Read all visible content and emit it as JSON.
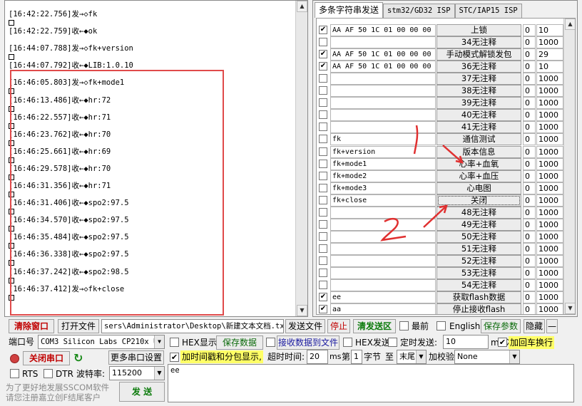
{
  "log": {
    "lines": [
      {
        "text": "[16:42:22.756]发→◇fk",
        "box": true
      },
      {
        "text": "[16:42:22.759]收←◆ok",
        "box": false
      },
      {
        "text": "[16:44:07.788]发→◇fk+version",
        "box": true
      },
      {
        "text": "[16:44:07.792]收←◆LIB:1.0.10",
        "box": false
      },
      {
        "text": "[16:46:05.803]发→◇fk+mode1",
        "box": true
      },
      {
        "text": "[16:46:13.486]收←◆hr:72",
        "box": true
      },
      {
        "text": "[16:46:22.557]收←◆hr:71",
        "box": true
      },
      {
        "text": "[16:46:23.762]收←◆hr:70",
        "box": true
      },
      {
        "text": "[16:46:25.661]收←◆hr:69",
        "box": true
      },
      {
        "text": "[16:46:29.578]收←◆hr:70",
        "box": true
      },
      {
        "text": "[16:46:31.356]收←◆hr:71",
        "box": true
      },
      {
        "text": "[16:46:31.406]收←◆spo2:97.5",
        "box": true
      },
      {
        "text": "[16:46:34.570]收←◆spo2:97.5",
        "box": true
      },
      {
        "text": "[16:46:35.484]收←◆spo2:97.5",
        "box": true
      },
      {
        "text": "[16:46:36.338]收←◆spo2:97.5",
        "box": true
      },
      {
        "text": "[16:46:37.242]收←◆spo2:98.5",
        "box": true
      },
      {
        "text": "[16:46:37.412]发→◇fk+close",
        "box": true
      }
    ]
  },
  "tabs": [
    "多条字符串发送",
    "stm32/GD32 ISP",
    "STC/IAP15 ISP"
  ],
  "commands": [
    {
      "checked": true,
      "data": "AA AF 50 1C 01 00 00 00",
      "label": "上锁",
      "order": "0",
      "delay": "10"
    },
    {
      "checked": false,
      "data": "",
      "label": "34无注释",
      "order": "0",
      "delay": "1000"
    },
    {
      "checked": true,
      "data": "AA AF 50 1C 01 00 00 00",
      "label": "手动模式解锁发包",
      "order": "0",
      "delay": "29"
    },
    {
      "checked": true,
      "data": "AA AF 50 1C 01 00 00 00",
      "label": "36无注释",
      "order": "0",
      "delay": "10"
    },
    {
      "checked": false,
      "data": "",
      "label": "37无注释",
      "order": "0",
      "delay": "1000"
    },
    {
      "checked": false,
      "data": "",
      "label": "38无注释",
      "order": "0",
      "delay": "1000"
    },
    {
      "checked": false,
      "data": "",
      "label": "39无注释",
      "order": "0",
      "delay": "1000"
    },
    {
      "checked": false,
      "data": "",
      "label": "40无注释",
      "order": "0",
      "delay": "1000"
    },
    {
      "checked": false,
      "data": "",
      "label": "41无注释",
      "order": "0",
      "delay": "1000"
    },
    {
      "checked": false,
      "data": "fk",
      "label": "通信测试",
      "order": "0",
      "delay": "1000"
    },
    {
      "checked": false,
      "data": "fk+version",
      "label": "版本信息",
      "order": "0",
      "delay": "1000"
    },
    {
      "checked": false,
      "data": "fk+mode1",
      "label": "心率+血氧",
      "order": "0",
      "delay": "1000"
    },
    {
      "checked": false,
      "data": "fk+mode2",
      "label": "心率+血压",
      "order": "0",
      "delay": "1000"
    },
    {
      "checked": false,
      "data": "fk+mode3",
      "label": "心电图",
      "order": "0",
      "delay": "1000"
    },
    {
      "checked": false,
      "data": "fk+close",
      "label": "关闭",
      "order": "0",
      "delay": "1000",
      "focused": true
    },
    {
      "checked": false,
      "data": "",
      "label": "48无注释",
      "order": "0",
      "delay": "1000"
    },
    {
      "checked": false,
      "data": "",
      "label": "49无注释",
      "order": "0",
      "delay": "1000"
    },
    {
      "checked": false,
      "data": "",
      "label": "50无注释",
      "order": "0",
      "delay": "1000"
    },
    {
      "checked": false,
      "data": "",
      "label": "51无注释",
      "order": "0",
      "delay": "1000"
    },
    {
      "checked": false,
      "data": "",
      "label": "52无注释",
      "order": "0",
      "delay": "1000"
    },
    {
      "checked": false,
      "data": "",
      "label": "53无注释",
      "order": "0",
      "delay": "1000"
    },
    {
      "checked": false,
      "data": "",
      "label": "54无注释",
      "order": "0",
      "delay": "1000"
    },
    {
      "checked": true,
      "data": "ee",
      "label": "获取flash数据",
      "order": "0",
      "delay": "1000"
    },
    {
      "checked": true,
      "data": "aa",
      "label": "停止接收flash",
      "order": "0",
      "delay": "1000"
    }
  ],
  "annotations": {
    "one": "1",
    "two": "2"
  },
  "toolbar1": {
    "clear_window": "清除窗口",
    "open_file": "打开文件",
    "file_path": "sers\\Administrator\\Desktop\\新建文本文档.txt",
    "send_file": "发送文件",
    "stop": "停止",
    "clear_send": "清发送区",
    "topmost": "最前",
    "english": "English",
    "save_params": "保存参数",
    "hide": "隐藏",
    "dash": "—"
  },
  "toolbar2": {
    "port_label": "端口号",
    "port_value": "COM3 Silicon Labs CP210x U",
    "hex_display": "HEX显示",
    "save_data": "保存数据",
    "recv_to_file": "接收数据到文件",
    "hex_send": "HEX发送",
    "timed_send": "定时发送:",
    "interval": "10",
    "interval_unit": "ms/次",
    "add_crlf": "加回车换行"
  },
  "toolbar3": {
    "close_port": "关闭串口",
    "more_settings": "更多串口设置",
    "timestamp": "加时间戳和分包显示,",
    "timeout_label": "超时时间:",
    "timeout_value": "20",
    "timeout_unit": "ms",
    "byte_prefix": "第",
    "byte_value": "1",
    "byte_suffix": "字节",
    "to": "至",
    "end_value": "末尾",
    "checksum_label": "加校验",
    "checksum_value": "None"
  },
  "toolbar4": {
    "rts": "RTS",
    "dtr": "DTR",
    "baud_label": "波特率:",
    "baud_value": "115200",
    "send": "发 送",
    "send_text": "ee"
  },
  "promo": {
    "line1": "为了更好地发展SSCOM软件",
    "line2": "请您注册嘉立创F结尾客户"
  },
  "colors": {
    "red_outline": "#e04a4a",
    "accent_red": "#c00000",
    "accent_green": "#0a7a0a",
    "highlight_yellow": "#ffff66"
  }
}
